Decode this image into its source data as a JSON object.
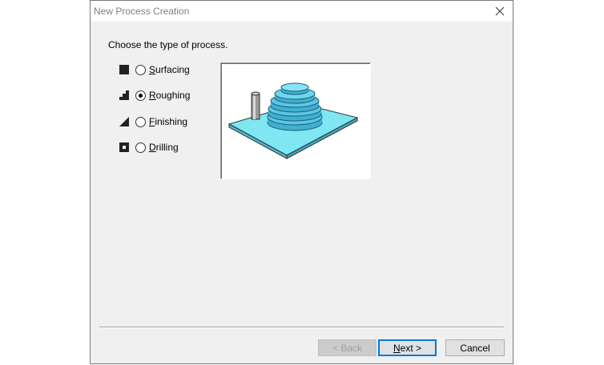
{
  "dialog": {
    "title": "New Process Creation",
    "prompt": "Choose the type of process.",
    "options": [
      {
        "label": "Surfacing",
        "icon": "filled-square-icon",
        "selected": false
      },
      {
        "label": "Roughing",
        "icon": "staircase-icon",
        "selected": true
      },
      {
        "label": "Finishing",
        "icon": "triangle-slope-icon",
        "selected": false
      },
      {
        "label": "Drilling",
        "icon": "hole-square-icon",
        "selected": false
      }
    ],
    "preview_icon": "roughing-preview-illustration"
  },
  "buttons": {
    "back": "< Back",
    "next": "Next >",
    "cancel": "Cancel"
  },
  "colors": {
    "accent": "#0078d7",
    "part": "#6fd5ef",
    "plate": "#7fe6f2"
  }
}
